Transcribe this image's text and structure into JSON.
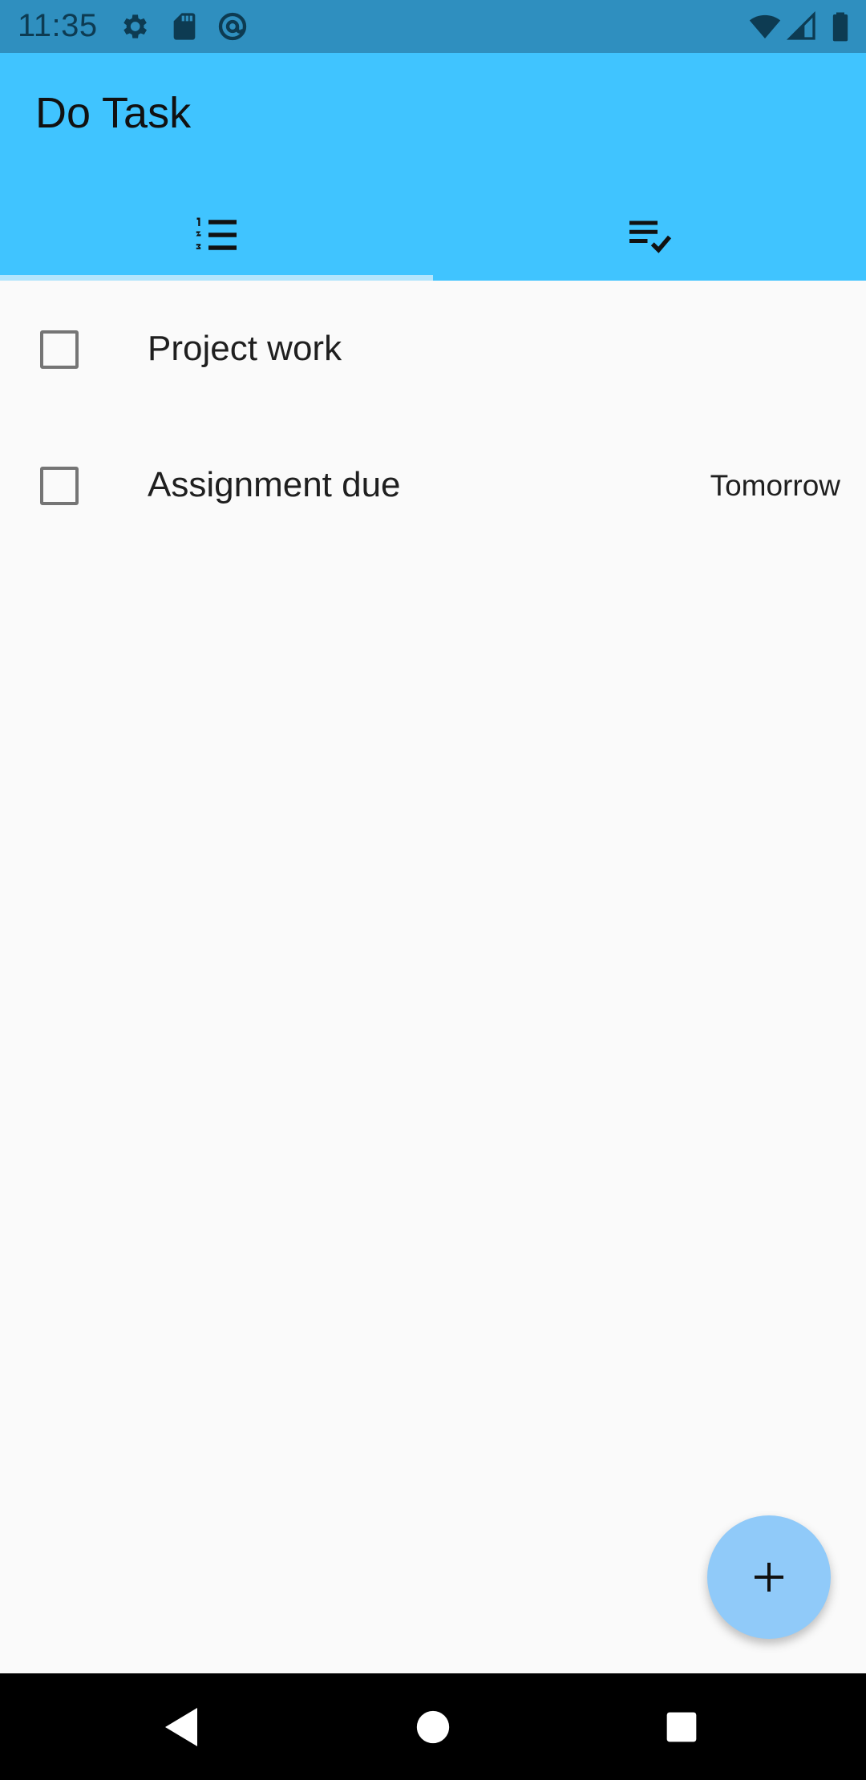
{
  "status_bar": {
    "time": "11:35",
    "left_icons": [
      "gear-icon",
      "sd-card-icon",
      "at-sign-icon"
    ],
    "right_icons": [
      "wifi-icon",
      "cell-signal-icon",
      "battery-icon"
    ]
  },
  "app_bar": {
    "title": "Do Task",
    "background": "#40c4ff",
    "tabs": [
      {
        "icon": "numbered-list-icon",
        "selected": true
      },
      {
        "icon": "playlist-check-icon",
        "selected": false
      }
    ]
  },
  "tasks": [
    {
      "title": "Project work",
      "due": "",
      "checked": false
    },
    {
      "title": "Assignment due",
      "due": "Tomorrow",
      "checked": false
    }
  ],
  "fab": {
    "icon": "plus-icon",
    "color": "#90caf9"
  },
  "nav_bar": {
    "buttons": [
      "back-icon",
      "home-icon",
      "recents-icon"
    ]
  }
}
